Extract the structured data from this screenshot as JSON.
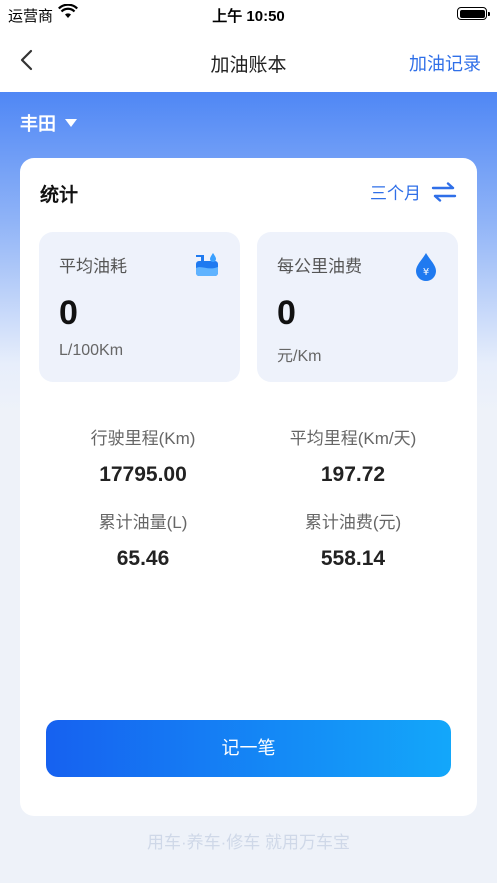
{
  "status_bar": {
    "carrier": "运营商",
    "time": "上午 10:50"
  },
  "nav": {
    "title": "加油账本",
    "right_link": "加油记录"
  },
  "car": {
    "name": "丰田"
  },
  "stats": {
    "title": "统计",
    "period": "三个月",
    "tiles": [
      {
        "label": "平均油耗",
        "value": "0",
        "unit": "L/100Km"
      },
      {
        "label": "每公里油费",
        "value": "0",
        "unit": "元/Km"
      }
    ],
    "items": [
      {
        "label": "行驶里程(Km)",
        "value": "17795.00"
      },
      {
        "label": "平均里程(Km/天)",
        "value": "197.72"
      },
      {
        "label": "累计油量(L)",
        "value": "65.46"
      },
      {
        "label": "累计油费(元)",
        "value": "558.14"
      }
    ]
  },
  "action_button": "记一笔",
  "footer": "用车·养车·修车 就用万车宝",
  "colors": {
    "accent": "#2f6fe8",
    "button_start": "#1661f0",
    "button_end": "#13a7fa"
  }
}
